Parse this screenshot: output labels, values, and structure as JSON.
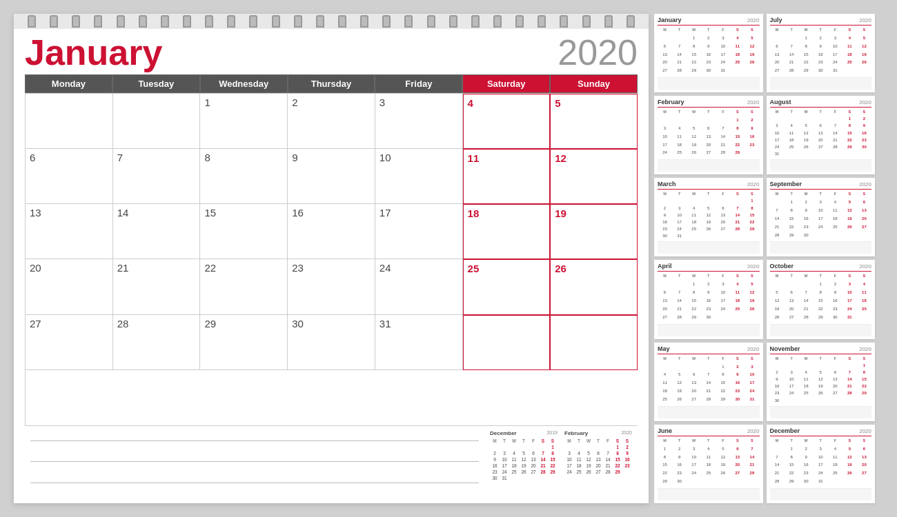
{
  "main": {
    "month": "January",
    "year": "2020",
    "days_header": [
      "Monday",
      "Tuesday",
      "Wednesday",
      "Thursday",
      "Friday",
      "Saturday",
      "Sunday"
    ],
    "spiral_count": 28
  },
  "cells": [
    {
      "num": "",
      "empty": true,
      "weekend": false
    },
    {
      "num": "",
      "empty": true,
      "weekend": false
    },
    {
      "num": "1",
      "empty": false,
      "weekend": false
    },
    {
      "num": "2",
      "empty": false,
      "weekend": false
    },
    {
      "num": "3",
      "empty": false,
      "weekend": false
    },
    {
      "num": "4",
      "empty": false,
      "weekend": true
    },
    {
      "num": "5",
      "empty": false,
      "weekend": true
    },
    {
      "num": "6",
      "empty": false,
      "weekend": false
    },
    {
      "num": "7",
      "empty": false,
      "weekend": false
    },
    {
      "num": "8",
      "empty": false,
      "weekend": false
    },
    {
      "num": "9",
      "empty": false,
      "weekend": false
    },
    {
      "num": "10",
      "empty": false,
      "weekend": false
    },
    {
      "num": "11",
      "empty": false,
      "weekend": true
    },
    {
      "num": "12",
      "empty": false,
      "weekend": true
    },
    {
      "num": "13",
      "empty": false,
      "weekend": false
    },
    {
      "num": "14",
      "empty": false,
      "weekend": false
    },
    {
      "num": "15",
      "empty": false,
      "weekend": false
    },
    {
      "num": "16",
      "empty": false,
      "weekend": false
    },
    {
      "num": "17",
      "empty": false,
      "weekend": false
    },
    {
      "num": "18",
      "empty": false,
      "weekend": true
    },
    {
      "num": "19",
      "empty": false,
      "weekend": true
    },
    {
      "num": "20",
      "empty": false,
      "weekend": false
    },
    {
      "num": "21",
      "empty": false,
      "weekend": false
    },
    {
      "num": "22",
      "empty": false,
      "weekend": false
    },
    {
      "num": "23",
      "empty": false,
      "weekend": false
    },
    {
      "num": "24",
      "empty": false,
      "weekend": false
    },
    {
      "num": "25",
      "empty": false,
      "weekend": true
    },
    {
      "num": "26",
      "empty": false,
      "weekend": true
    },
    {
      "num": "27",
      "empty": false,
      "weekend": false
    },
    {
      "num": "28",
      "empty": false,
      "weekend": false
    },
    {
      "num": "29",
      "empty": false,
      "weekend": false
    },
    {
      "num": "30",
      "empty": false,
      "weekend": false
    },
    {
      "num": "31",
      "empty": false,
      "weekend": false
    },
    {
      "num": "",
      "empty": true,
      "weekend": true
    },
    {
      "num": "",
      "empty": true,
      "weekend": true
    }
  ],
  "footer_prev": {
    "name": "December",
    "year": "2019",
    "days": [
      "Mon",
      "Tue",
      "Wed",
      "Thu",
      "Fri",
      "Sat",
      "Sun"
    ],
    "rows": [
      [
        "",
        "",
        "",
        "",
        "",
        "",
        "1"
      ],
      [
        "2",
        "3",
        "4",
        "5",
        "6",
        "7",
        "8"
      ],
      [
        "9",
        "10",
        "11",
        "12",
        "13",
        "14",
        "15"
      ],
      [
        "16",
        "17",
        "18",
        "19",
        "20",
        "21",
        "22"
      ],
      [
        "23",
        "24",
        "25",
        "26",
        "27",
        "28",
        "29"
      ],
      [
        "30",
        "31",
        "",
        "",
        "",
        "",
        ""
      ]
    ]
  },
  "footer_next": {
    "name": "February",
    "year": "2020",
    "days": [
      "Mon",
      "Tue",
      "Wed",
      "Thu",
      "Fri",
      "Sat",
      "Sun"
    ],
    "rows": [
      [
        "",
        "",
        "",
        "",
        "",
        "1",
        "2"
      ],
      [
        "3",
        "4",
        "5",
        "6",
        "7",
        "8",
        "9"
      ],
      [
        "10",
        "11",
        "12",
        "13",
        "14",
        "15",
        "16"
      ],
      [
        "17",
        "18",
        "19",
        "20",
        "21",
        "22",
        "23"
      ],
      [
        "24",
        "25",
        "26",
        "27",
        "28",
        "29",
        ""
      ]
    ]
  },
  "side_months": [
    {
      "name": "January",
      "year": "2020",
      "col": 0,
      "row": 0,
      "days": [
        "Mon",
        "Tue",
        "Wed",
        "Thu",
        "Fri",
        "Sat",
        "Sun"
      ],
      "rows": [
        [
          "",
          "",
          "1",
          "2",
          "3",
          "4",
          "5"
        ],
        [
          "6",
          "7",
          "8",
          "9",
          "10",
          "11",
          "12"
        ],
        [
          "13",
          "14",
          "15",
          "16",
          "17",
          "18",
          "19"
        ],
        [
          "20",
          "21",
          "22",
          "23",
          "24",
          "25",
          "26"
        ],
        [
          "27",
          "28",
          "29",
          "30",
          "31",
          "",
          ""
        ]
      ]
    },
    {
      "name": "July",
      "year": "2020",
      "col": 1,
      "row": 0,
      "days": [
        "Mon",
        "Tue",
        "Wed",
        "Thu",
        "Fri",
        "Sat",
        "Sun"
      ],
      "rows": [
        [
          "",
          "",
          "1",
          "2",
          "3",
          "4",
          "5"
        ],
        [
          "6",
          "7",
          "8",
          "9",
          "10",
          "11",
          "12"
        ],
        [
          "13",
          "14",
          "15",
          "16",
          "17",
          "18",
          "19"
        ],
        [
          "20",
          "21",
          "22",
          "23",
          "24",
          "25",
          "26"
        ],
        [
          "27",
          "28",
          "29",
          "30",
          "31",
          "",
          ""
        ]
      ]
    },
    {
      "name": "February",
      "year": "2020",
      "col": 0,
      "row": 1,
      "days": [
        "Mon",
        "Tue",
        "Wed",
        "Thu",
        "Fri",
        "Sat",
        "Sun"
      ],
      "rows": [
        [
          "",
          "",
          "",
          "",
          "",
          "1",
          "2"
        ],
        [
          "3",
          "4",
          "5",
          "6",
          "7",
          "8",
          "9"
        ],
        [
          "10",
          "11",
          "12",
          "13",
          "14",
          "15",
          "16"
        ],
        [
          "17",
          "18",
          "19",
          "20",
          "21",
          "22",
          "23"
        ],
        [
          "24",
          "25",
          "26",
          "27",
          "28",
          "29",
          ""
        ]
      ]
    },
    {
      "name": "August",
      "year": "2020",
      "col": 1,
      "row": 1,
      "days": [
        "Mon",
        "Tue",
        "Wed",
        "Thu",
        "Fri",
        "Sat",
        "Sun"
      ],
      "rows": [
        [
          "",
          "",
          "",
          "",
          "",
          "1",
          "2"
        ],
        [
          "3",
          "4",
          "5",
          "6",
          "7",
          "8",
          "9"
        ],
        [
          "10",
          "11",
          "12",
          "13",
          "14",
          "15",
          "16"
        ],
        [
          "17",
          "18",
          "19",
          "20",
          "21",
          "22",
          "23"
        ],
        [
          "24",
          "25",
          "26",
          "27",
          "28",
          "29",
          "30"
        ],
        [
          "31",
          "",
          "",
          "",
          "",
          "",
          ""
        ]
      ]
    },
    {
      "name": "March",
      "year": "2020",
      "col": 0,
      "row": 2,
      "days": [
        "Mon",
        "Tue",
        "Wed",
        "Thu",
        "Fri",
        "Sat",
        "Sun"
      ],
      "rows": [
        [
          "",
          "",
          "",
          "",
          "",
          "",
          "1"
        ],
        [
          "2",
          "3",
          "4",
          "5",
          "6",
          "7",
          "8"
        ],
        [
          "9",
          "10",
          "11",
          "12",
          "13",
          "14",
          "15"
        ],
        [
          "16",
          "17",
          "18",
          "19",
          "20",
          "21",
          "22"
        ],
        [
          "23",
          "24",
          "25",
          "26",
          "27",
          "28",
          "29"
        ],
        [
          "30",
          "31",
          "",
          "",
          "",
          "",
          ""
        ]
      ]
    },
    {
      "name": "September",
      "year": "2020",
      "col": 1,
      "row": 2,
      "days": [
        "Mon",
        "Tue",
        "Wed",
        "Thu",
        "Fri",
        "Sat",
        "Sun"
      ],
      "rows": [
        [
          "",
          "1",
          "2",
          "3",
          "4",
          "5",
          "6"
        ],
        [
          "7",
          "8",
          "9",
          "10",
          "11",
          "12",
          "13"
        ],
        [
          "14",
          "15",
          "16",
          "17",
          "18",
          "19",
          "20"
        ],
        [
          "21",
          "22",
          "23",
          "24",
          "25",
          "26",
          "27"
        ],
        [
          "28",
          "29",
          "30",
          "",
          "",
          "",
          ""
        ]
      ]
    },
    {
      "name": "April",
      "year": "2020",
      "col": 0,
      "row": 3,
      "days": [
        "Mon",
        "Tue",
        "Wed",
        "Thu",
        "Fri",
        "Sat",
        "Sun"
      ],
      "rows": [
        [
          "",
          "",
          "1",
          "2",
          "3",
          "4",
          "5"
        ],
        [
          "6",
          "7",
          "8",
          "9",
          "10",
          "11",
          "12"
        ],
        [
          "13",
          "14",
          "15",
          "16",
          "17",
          "18",
          "19"
        ],
        [
          "20",
          "21",
          "22",
          "23",
          "24",
          "25",
          "26"
        ],
        [
          "27",
          "28",
          "29",
          "30",
          "",
          "",
          ""
        ]
      ]
    },
    {
      "name": "October",
      "year": "2020",
      "col": 1,
      "row": 3,
      "days": [
        "Mon",
        "Tue",
        "Wed",
        "Thu",
        "Fri",
        "Sat",
        "Sun"
      ],
      "rows": [
        [
          "",
          "",
          "",
          "1",
          "2",
          "3",
          "4"
        ],
        [
          "5",
          "6",
          "7",
          "8",
          "9",
          "10",
          "11"
        ],
        [
          "12",
          "13",
          "14",
          "15",
          "16",
          "17",
          "18"
        ],
        [
          "19",
          "20",
          "21",
          "22",
          "23",
          "24",
          "25"
        ],
        [
          "26",
          "27",
          "28",
          "29",
          "30",
          "31",
          ""
        ]
      ]
    },
    {
      "name": "May",
      "year": "2020",
      "col": 0,
      "row": 4,
      "days": [
        "Mon",
        "Tue",
        "Wed",
        "Thu",
        "Fri",
        "Sat",
        "Sun"
      ],
      "rows": [
        [
          "",
          "",
          "",
          "",
          "1",
          "2",
          "3"
        ],
        [
          "4",
          "5",
          "6",
          "7",
          "8",
          "9",
          "10"
        ],
        [
          "11",
          "12",
          "13",
          "14",
          "15",
          "16",
          "17"
        ],
        [
          "18",
          "19",
          "20",
          "21",
          "22",
          "23",
          "24"
        ],
        [
          "25",
          "26",
          "27",
          "28",
          "29",
          "30",
          "31"
        ]
      ]
    },
    {
      "name": "November",
      "year": "2020",
      "col": 1,
      "row": 4,
      "days": [
        "Mon",
        "Tue",
        "Wed",
        "Thu",
        "Fri",
        "Sat",
        "Sun"
      ],
      "rows": [
        [
          "",
          "",
          "",
          "",
          "",
          "",
          "1"
        ],
        [
          "2",
          "3",
          "4",
          "5",
          "6",
          "7",
          "8"
        ],
        [
          "9",
          "10",
          "11",
          "12",
          "13",
          "14",
          "15"
        ],
        [
          "16",
          "17",
          "18",
          "19",
          "20",
          "21",
          "22"
        ],
        [
          "23",
          "24",
          "25",
          "26",
          "27",
          "28",
          "29"
        ],
        [
          "30",
          "",
          "",
          "",
          "",
          "",
          ""
        ]
      ]
    },
    {
      "name": "June",
      "year": "2020",
      "col": 0,
      "row": 5,
      "days": [
        "Mon",
        "Tue",
        "Wed",
        "Thu",
        "Fri",
        "Sat",
        "Sun"
      ],
      "rows": [
        [
          "1",
          "2",
          "3",
          "4",
          "5",
          "6",
          "7"
        ],
        [
          "8",
          "9",
          "10",
          "11",
          "12",
          "13",
          "14"
        ],
        [
          "15",
          "16",
          "17",
          "18",
          "19",
          "20",
          "21"
        ],
        [
          "22",
          "23",
          "24",
          "25",
          "26",
          "27",
          "28"
        ],
        [
          "29",
          "30",
          "",
          "",
          "",
          "",
          ""
        ]
      ]
    },
    {
      "name": "December",
      "year": "2020",
      "col": 1,
      "row": 5,
      "days": [
        "Mon",
        "Tue",
        "Wed",
        "Thu",
        "Fri",
        "Sat",
        "Sun"
      ],
      "rows": [
        [
          "",
          "1",
          "2",
          "3",
          "4",
          "5",
          "6"
        ],
        [
          "7",
          "8",
          "9",
          "10",
          "11",
          "12",
          "13"
        ],
        [
          "14",
          "15",
          "16",
          "17",
          "18",
          "19",
          "20"
        ],
        [
          "21",
          "22",
          "23",
          "24",
          "25",
          "26",
          "27"
        ],
        [
          "28",
          "29",
          "30",
          "31",
          "",
          "",
          ""
        ]
      ]
    }
  ]
}
